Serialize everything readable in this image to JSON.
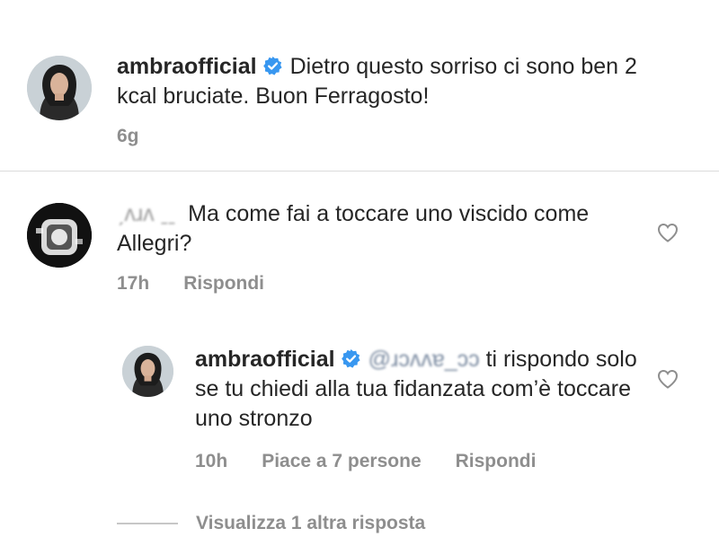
{
  "caption": {
    "username": "ambraofficial",
    "verified": true,
    "text": "Dietro questo sorriso ci sono ben 2 kcal bruciate. Buon Ferragosto!",
    "time": "6g"
  },
  "comment": {
    "username_blurred": "ˏʌɹʌ ˍˍ",
    "text": "Ma come fai a toccare uno viscido come Allegri?",
    "time": "17h",
    "reply_label": "Rispondi"
  },
  "reply": {
    "username": "ambraofficial",
    "verified": true,
    "mention_blurred": "@ɹɔʌʌɐ_ɔɔ",
    "text_after_mention": "ti rispondo solo se tu chiedi alla tua fidanzata com’è toccare uno stronzo",
    "time": "10h",
    "likes_label": "Piace a 7 persone",
    "reply_label": "Rispondi"
  },
  "view_more_replies": "Visualizza 1 altra risposta",
  "colors": {
    "text": "#262626",
    "meta": "#8e8e8e",
    "verified_badge": "#3897f0",
    "divider": "#dbdbdb"
  },
  "icons": {
    "verified": "verified-badge-icon",
    "like": "heart-outline-icon"
  }
}
